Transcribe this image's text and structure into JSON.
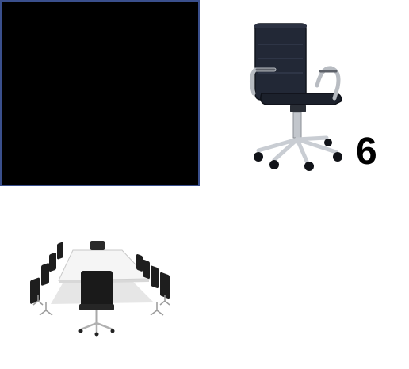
{
  "count_label": "6",
  "colors": {
    "panel_fill": "#000000",
    "panel_border": "#3a4f8c",
    "chair_upholstery": "#1f2530",
    "chrome": "#b8bcc2"
  },
  "images": {
    "chair": "office-chair-image",
    "table": "conference-table-image"
  }
}
